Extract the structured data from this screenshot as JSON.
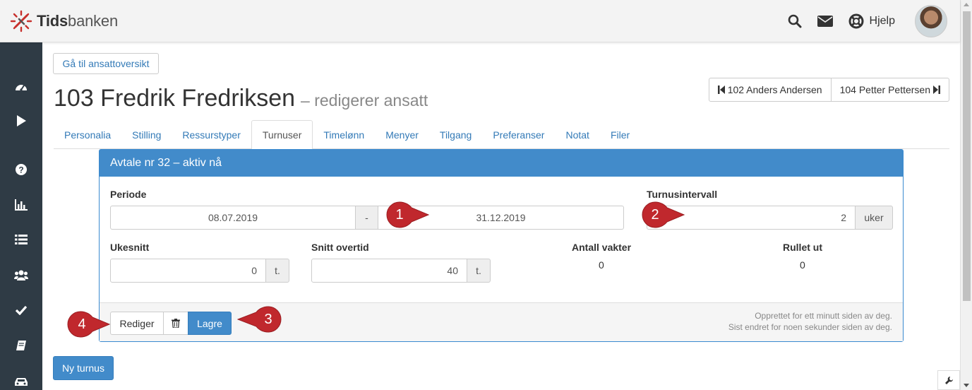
{
  "app": {
    "logo_bold": "Tids",
    "logo_rest": "banken"
  },
  "header": {
    "help_label": "Hjelp"
  },
  "back_button_label": "Gå til ansattoversikt",
  "employee": {
    "title": "103 Fredrik Fredriksen",
    "subtitle": "– redigerer ansatt"
  },
  "pager": {
    "prev_label": "102 Anders Andersen",
    "next_label": "104 Petter Pettersen"
  },
  "tabs": [
    {
      "label": "Personalia"
    },
    {
      "label": "Stilling"
    },
    {
      "label": "Ressurstyper"
    },
    {
      "label": "Turnuser",
      "active": true
    },
    {
      "label": "Timelønn"
    },
    {
      "label": "Menyer"
    },
    {
      "label": "Tilgang"
    },
    {
      "label": "Preferanser"
    },
    {
      "label": "Notat"
    },
    {
      "label": "Filer"
    }
  ],
  "agreement": {
    "header": "Avtale nr 32 – aktiv nå",
    "period_label": "Periode",
    "period_from": "08.07.2019",
    "period_separator": "-",
    "period_to": "31.12.2019",
    "interval_label": "Turnusintervall",
    "interval_value": "2",
    "interval_unit": "uker",
    "weekly_avg_label": "Ukesnitt",
    "weekly_avg_value": "0",
    "weekly_avg_unit": "t.",
    "overtime_label": "Snitt overtid",
    "overtime_value": "40",
    "overtime_unit": "t.",
    "shifts_label": "Antall vakter",
    "shifts_value": "0",
    "rolled_label": "Rullet ut",
    "rolled_value": "0",
    "edit_label": "Rediger",
    "save_label": "Lagre",
    "created_note": "Opprettet for ett minutt siden av deg.",
    "edited_note": "Sist endret for noen sekunder siden av deg."
  },
  "new_rota_label": "Ny turnus",
  "callouts": {
    "c1": "1",
    "c2": "2",
    "c3": "3",
    "c4": "4"
  },
  "colors": {
    "primary": "#428bca",
    "sidebar": "#2f3b45",
    "callout": "#c0282d",
    "link": "#337ab7"
  }
}
